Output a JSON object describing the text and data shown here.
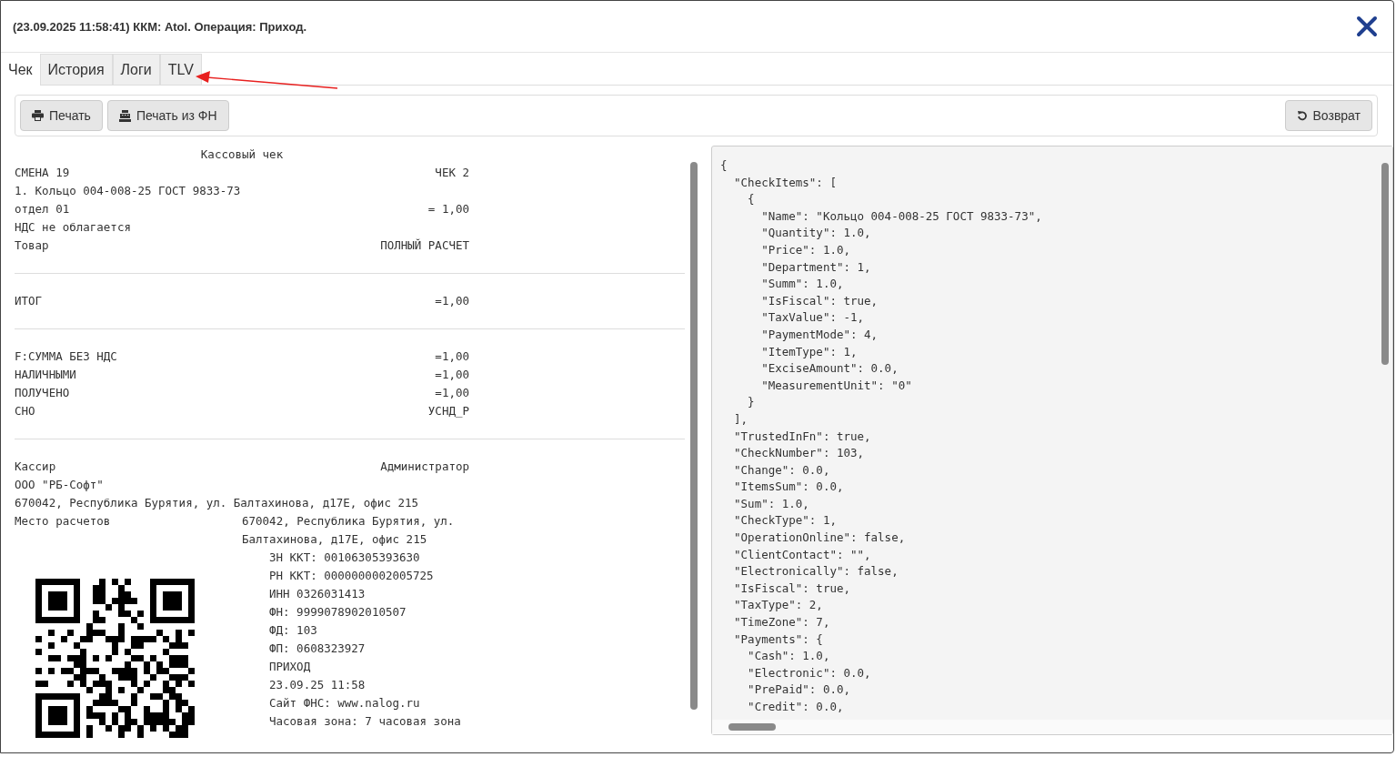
{
  "window": {
    "title": "(23.09.2025 11:58:41) ККМ: Atol. Операция: Приход."
  },
  "tabs": [
    {
      "label": "Чек",
      "selected": true
    },
    {
      "label": "История",
      "selected": false
    },
    {
      "label": "Логи",
      "selected": false
    },
    {
      "label": "TLV",
      "selected": false
    }
  ],
  "toolbar": {
    "left_buttons": [
      {
        "label": "Печать",
        "kind": "print"
      },
      {
        "label": "Печать из ФН",
        "kind": "register"
      }
    ],
    "right_buttons": [
      {
        "label": "Возврат",
        "kind": "undo"
      }
    ]
  },
  "receipt": {
    "title": "Кассовый чек",
    "sections": [
      [
        {
          "left": "СМЕНА 19",
          "right": "ЧЕК 2"
        },
        {
          "left": "1. Кольцо 004-008-25 ГОСТ 9833-73"
        },
        {
          "left": "отдел 01",
          "right": "= 1,00"
        },
        {
          "left": "НДС не облагается"
        },
        {
          "left": "Товар",
          "right": "ПОЛНЫЙ РАСЧЕТ"
        }
      ],
      [
        {
          "left": "ИТОГ",
          "right": "=1,00"
        }
      ],
      [
        {
          "left": "F:СУММА БЕЗ НДС",
          "right": "=1,00"
        },
        {
          "left": "НАЛИЧНЫМИ",
          "right": "=1,00"
        },
        {
          "left": "ПОЛУЧЕНО",
          "right": "=1,00"
        },
        {
          "left": "СНО",
          "right": "УСНД_Р"
        }
      ]
    ],
    "footer": [
      {
        "left": "Кассир",
        "right": "Администратор"
      },
      {
        "left": "ООО \"РБ-Софт\""
      },
      {
        "left": "670042, Республика Бурятия, ул. Балтахинова, д17Е, офис 215"
      }
    ],
    "place": {
      "label": "Место расчетов",
      "lines": [
        "670042, Республика Бурятия, ул.",
        "Балтахинова, д17Е, офис 215"
      ]
    },
    "details": [
      "ЗН ККТ: 00106305393630",
      "РН ККТ: 0000000002005725",
      "ИНН 0326031413",
      "ФН: 9999078902010507",
      "ФД: 103",
      "ФП: 0608323927",
      "ПРИХОД",
      "23.09.25 11:58",
      "Сайт ФНС: www.nalog.ru",
      "Часовая зона: 7 часовая зона"
    ]
  },
  "json_view": {
    "code": "{\n  \"CheckItems\": [\n    {\n      \"Name\": \"Кольцо 004-008-25 ГОСТ 9833-73\",\n      \"Quantity\": 1.0,\n      \"Price\": 1.0,\n      \"Department\": 1,\n      \"Summ\": 1.0,\n      \"IsFiscal\": true,\n      \"TaxValue\": -1,\n      \"PaymentMode\": 4,\n      \"ItemType\": 1,\n      \"ExciseAmount\": 0.0,\n      \"MeasurementUnit\": \"0\"\n    }\n  ],\n  \"TrustedInFn\": true,\n  \"CheckNumber\": 103,\n  \"Change\": 0.0,\n  \"ItemsSum\": 0.0,\n  \"Sum\": 1.0,\n  \"CheckType\": 1,\n  \"OperationOnline\": false,\n  \"ClientContact\": \"\",\n  \"Electronically\": false,\n  \"IsFiscal\": true,\n  \"TaxType\": 2,\n  \"TimeZone\": 7,\n  \"Payments\": {\n    \"Cash\": 1.0,\n    \"Electronic\": 0.0,\n    \"PrePaid\": 0.0,\n    \"Credit\": 0.0,"
  }
}
